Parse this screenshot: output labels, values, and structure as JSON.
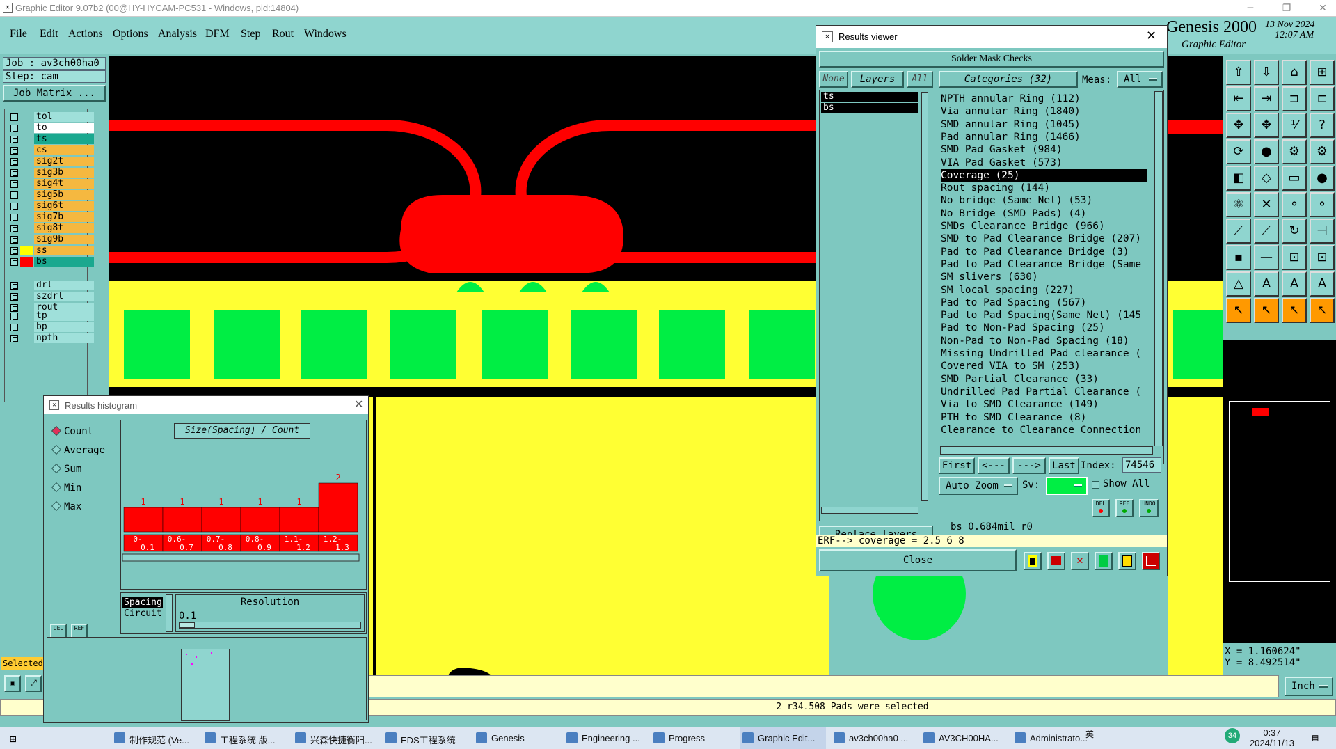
{
  "window": {
    "title": "Graphic Editor 9.07b2 (00@HY-HYCAM-PC531 - Windows, pid:14804)"
  },
  "menu": [
    "File",
    "Edit",
    "Actions",
    "Options",
    "Analysis",
    "DFM",
    "Step",
    "Rout",
    "Windows"
  ],
  "brand": {
    "name": "Genesis 2000",
    "sub": "Graphic Editor",
    "date": "13 Nov 2024",
    "time": "12:07 AM"
  },
  "left": {
    "job": "Job : av3ch00ha0",
    "step": "Step: cam",
    "job_matrix": "Job Matrix ...",
    "layers_a": [
      {
        "name": "tol",
        "color": "#9fe0da"
      },
      {
        "name": "to",
        "color": "#ffffff"
      },
      {
        "name": "ts",
        "color": "#1aa88f"
      },
      {
        "name": "cs",
        "color": "#f5b840"
      },
      {
        "name": "sig2t",
        "color": "#f5b840"
      },
      {
        "name": "sig3b",
        "color": "#f5b840"
      },
      {
        "name": "sig4t",
        "color": "#f5b840"
      },
      {
        "name": "sig5b",
        "color": "#f5b840"
      },
      {
        "name": "sig6t",
        "color": "#f5b840"
      },
      {
        "name": "sig7b",
        "color": "#f5b840"
      },
      {
        "name": "sig8t",
        "color": "#f5b840"
      },
      {
        "name": "sig9b",
        "color": "#f5b840"
      },
      {
        "name": "ss",
        "color": "#f5b840"
      },
      {
        "name": "bs",
        "color": "#1aa88f"
      }
    ],
    "layers_b": [
      {
        "name": "drl"
      },
      {
        "name": "szdrl"
      },
      {
        "name": "rout"
      }
    ],
    "layers_c": [
      {
        "name": "tp"
      },
      {
        "name": "bp"
      },
      {
        "name": "npth"
      }
    ],
    "selected": "Selected"
  },
  "results_viewer": {
    "title": "Results viewer",
    "header": "Solder Mask Checks",
    "tabs": [
      "None",
      "Layers",
      "All"
    ],
    "layers": [
      "ts",
      "bs"
    ],
    "categories_label": "Categories (32)",
    "meas_label": "Meas:",
    "meas_value": "All",
    "categories": [
      "NPTH annular Ring (112)",
      "Via annular Ring (1840)",
      "SMD annular Ring (1045)",
      "Pad annular Ring (1466)",
      "SMD Pad Gasket (984)",
      "VIA Pad Gasket (573)",
      "Coverage (25)",
      "Rout spacing (144)",
      "No bridge (Same Net) (53)",
      "No Bridge (SMD Pads) (4)",
      "SMDs Clearance Bridge (966)",
      "SMD to Pad Clearance Bridge (207)",
      "Pad to Pad Clearance Bridge (3)",
      "Pad to Pad Clearance Bridge (Same",
      "SM slivers (630)",
      "SM local spacing (227)",
      "Pad to Pad Spacing (567)",
      "Pad to Pad Spacing(Same Net) (145",
      "Pad to Non-Pad Spacing (25)",
      "Non-Pad to Non-Pad Spacing (18)",
      "Missing Undrilled Pad clearance (",
      "Covered VIA to SM (253)",
      "SMD Partial Clearance (33)",
      "Undrilled Pad Partial Clearance (",
      "Via to SMD Clearance (149)",
      "PTH to SMD Clearance (8)",
      "Clearance to Clearance Connection"
    ],
    "selected_index": 6,
    "nav": {
      "first": "First",
      "prev": "<---",
      "next": "--->",
      "last": "Last",
      "index_label": "Index:",
      "index_value": "74546"
    },
    "auto_zoom": "Auto Zoom",
    "sv_label": "Sv:",
    "show_all": "Show All",
    "replace_layers": "Replace layers",
    "small_btns": [
      "DEL",
      "REF",
      "UNDO"
    ],
    "status": "bs  0.684mil  r0",
    "erf": "ERF--> coverage = 2.5 6 8",
    "close": "Close"
  },
  "histogram": {
    "title": "Results histogram",
    "modes": [
      "Count",
      "Average",
      "Sum",
      "Min",
      "Max"
    ],
    "selected_mode": "Count",
    "chart_title": "Size(Spacing) / Count",
    "lists": [
      "Spacing",
      "Circuit"
    ],
    "resolution_label": "Resolution",
    "resolution_value": "0.1",
    "btns": [
      "DEL",
      "REF"
    ]
  },
  "chart_data": {
    "type": "bar",
    "title": "Size(Spacing) / Count",
    "categories": [
      "0-0.1",
      "0.6-0.7",
      "0.7-0.8",
      "0.8-0.9",
      "1.1-1.2",
      "1.2-1.3"
    ],
    "values": [
      1,
      1,
      1,
      1,
      1,
      2
    ],
    "color": "#ff0000"
  },
  "coords": {
    "x": "X = 1.160624\"",
    "y": "Y = 8.492514\""
  },
  "units": "Inch",
  "status_bottom": "2 r34.508 Pads were selected",
  "taskbar": {
    "items": [
      "制作规范 (Ve...",
      "工程系统  版...",
      "兴森快捷衡阳...",
      "EDS工程系统",
      "Genesis",
      "Engineering ...",
      "Progress",
      "Graphic Edit...",
      "av3ch00ha0 ...",
      "AV3CH00HA...",
      "Administrato..."
    ],
    "time": "0:37",
    "date": "2024/11/13",
    "lang": "英",
    "badge": "34"
  },
  "colors": {
    "accent": "#7ec8c0",
    "pad": "#00ee44",
    "mask": "#ff0000",
    "copper": "#ffff33"
  }
}
